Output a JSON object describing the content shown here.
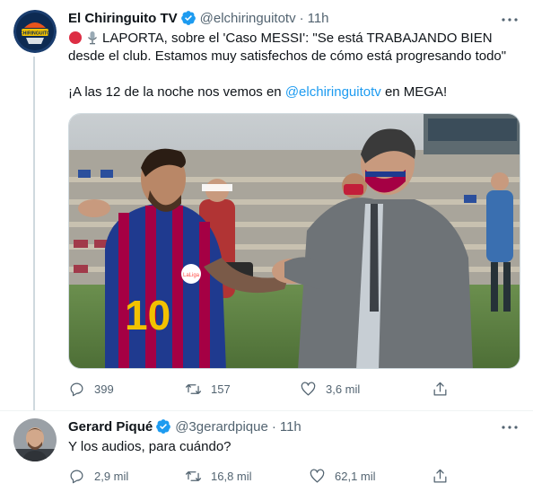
{
  "tweets": [
    {
      "author": {
        "name": "El Chiringuito TV",
        "handle": "@elchiringuitotv",
        "avatar_icon": "chiringuito-logo-icon",
        "avatar_text": "CHIRINGUITO"
      },
      "time": "11h",
      "text_line1_prefix": "LAPORTA, sobre el 'Caso MESSI': \"Se está TRABAJANDO BIEN desde el club. Estamos muy satisfechos de cómo está progresando todo\"",
      "text_line2_prefix": "¡A las 12 de la noche nos vemos en ",
      "text_line2_mention": "@elchiringuitotv",
      "text_line2_suffix": " en MEGA!",
      "media": {
        "shirt_number": "10",
        "badge": "LaLiga"
      },
      "stats": {
        "replies": "399",
        "retweets": "157",
        "likes": "3,6 mil"
      }
    },
    {
      "author": {
        "name": "Gerard Piqué",
        "handle": "@3gerardpique",
        "avatar_icon": "profile-photo-icon"
      },
      "time": "11h",
      "text": "Y los audios, para cuándo?",
      "stats": {
        "replies": "2,9 mil",
        "retweets": "16,8 mil",
        "likes": "62,1 mil"
      }
    }
  ],
  "colors": {
    "accent": "#1d9bf0",
    "text": "#0f1419",
    "muted": "#536471",
    "border": "#cfd9de"
  }
}
